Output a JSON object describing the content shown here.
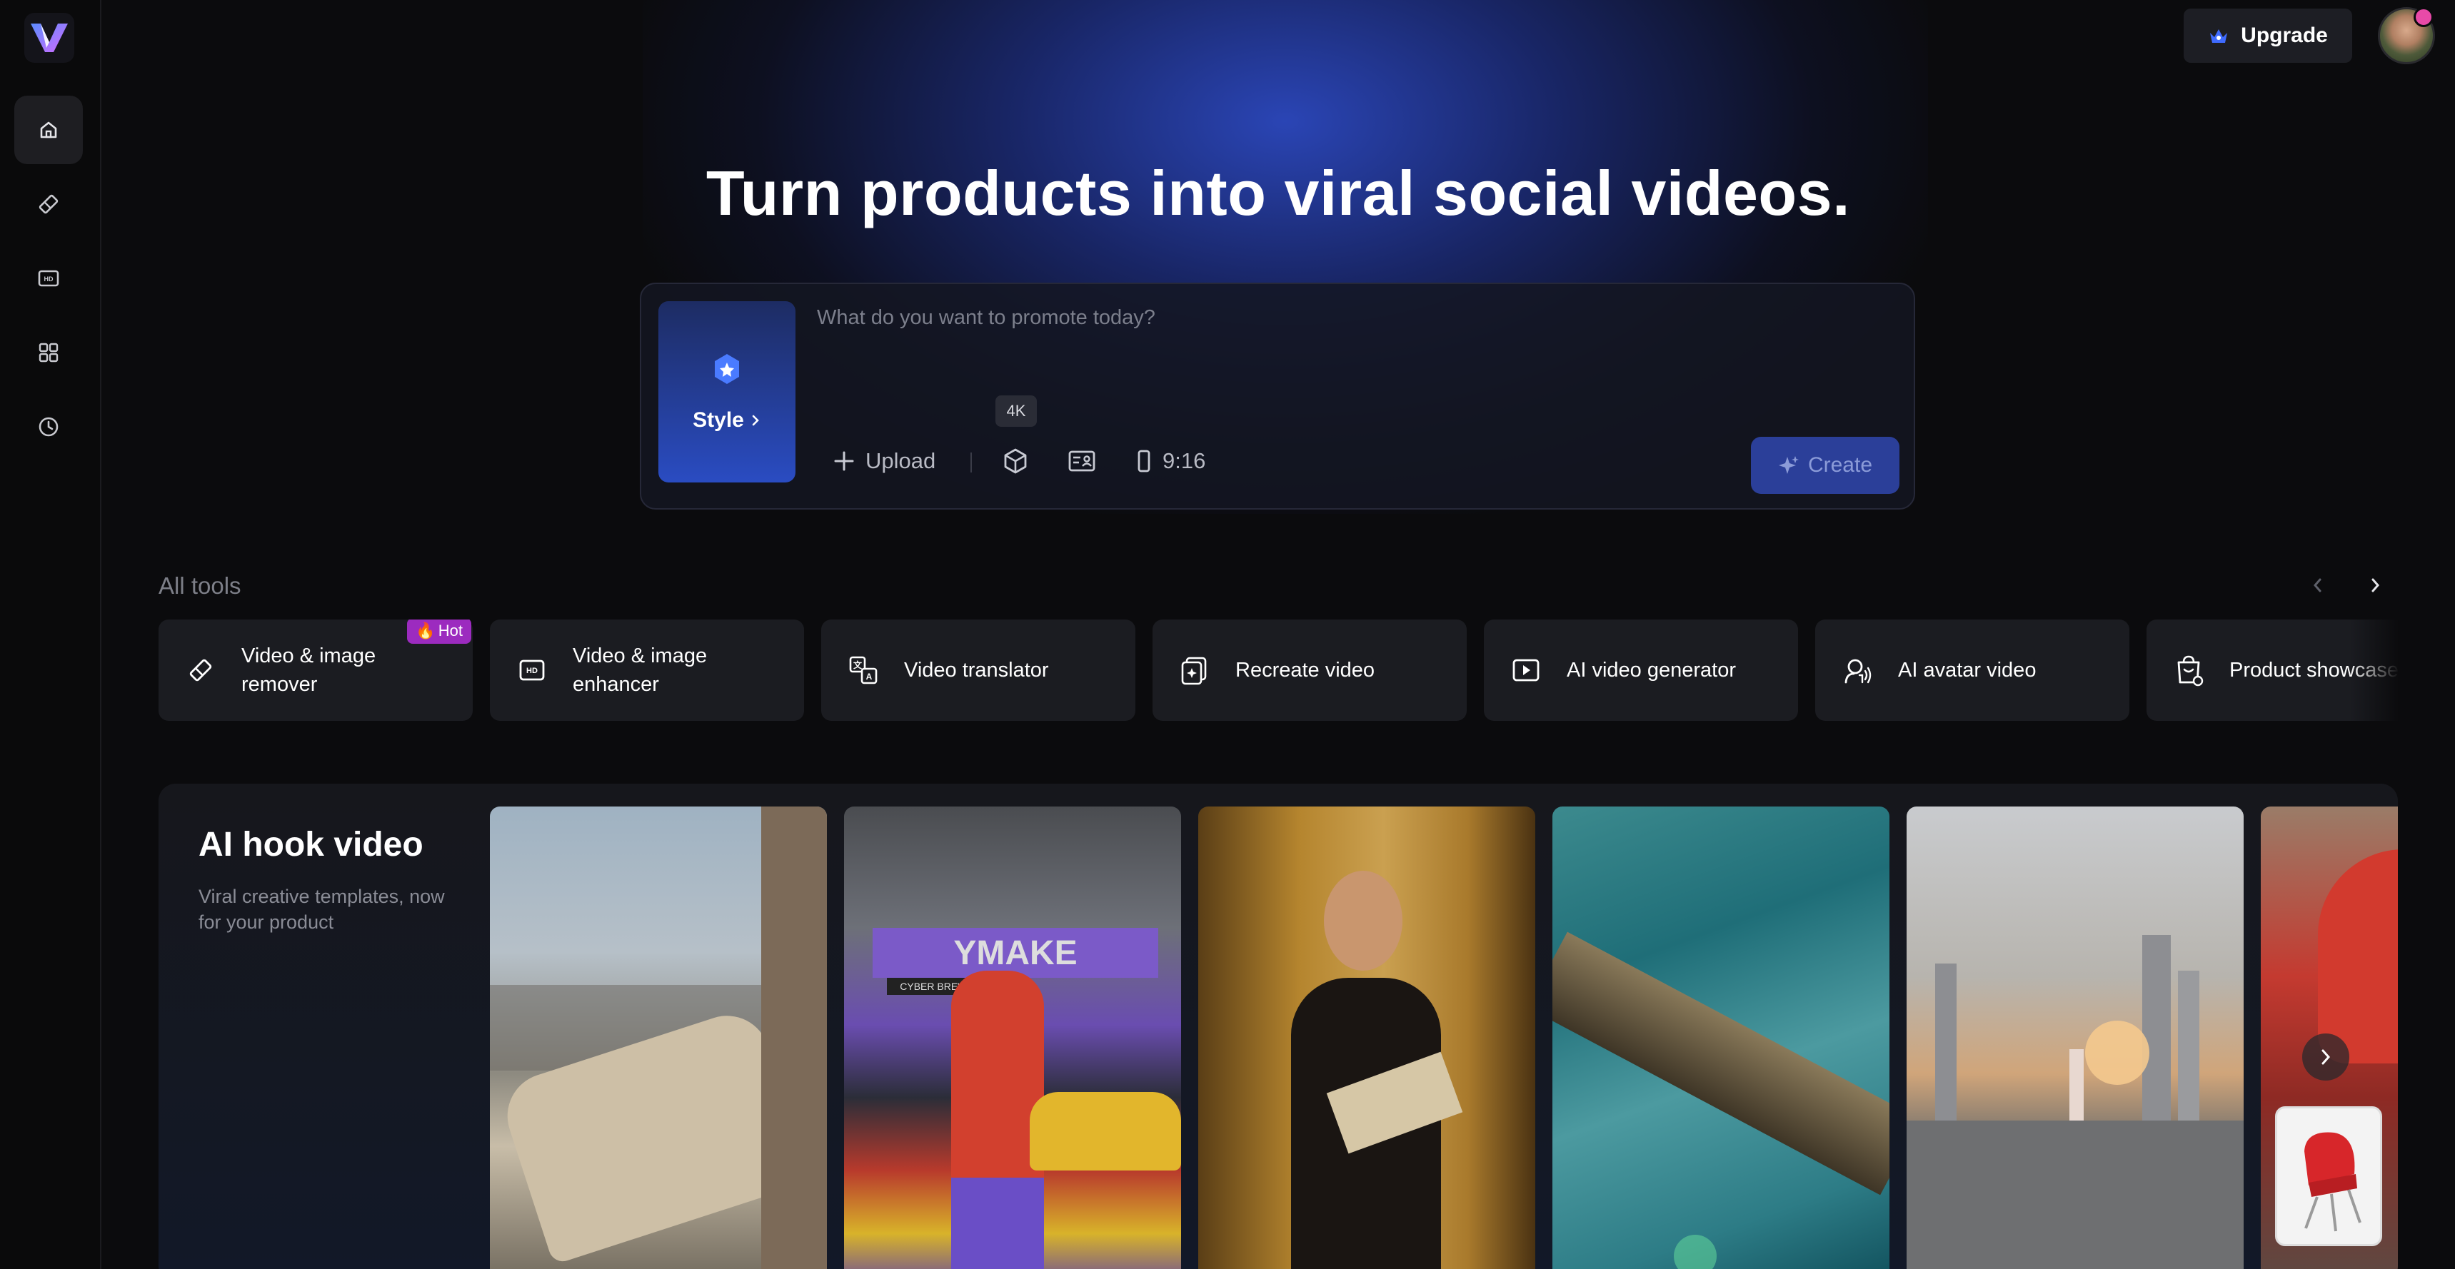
{
  "header": {
    "upgrade_label": "Upgrade",
    "headline": "Turn products into viral social videos."
  },
  "sidebar": {
    "items": [
      {
        "name": "home",
        "active": true
      },
      {
        "name": "eraser",
        "active": false
      },
      {
        "name": "hd",
        "active": false
      },
      {
        "name": "apps",
        "active": false
      },
      {
        "name": "history",
        "active": false
      }
    ]
  },
  "prompt": {
    "placeholder": "What do you want to promote today?",
    "style_label": "Style",
    "upload_label": "Upload",
    "tooltip": "4K",
    "ratio": "9:16",
    "create_label": "Create"
  },
  "tools": {
    "title": "All tools",
    "hot_label": "Hot",
    "items": [
      {
        "label": "Video & image remover",
        "icon": "eraser-icon"
      },
      {
        "label": "Video & image enhancer",
        "icon": "hd-icon"
      },
      {
        "label": "Video translator",
        "icon": "translate-icon"
      },
      {
        "label": "Recreate video",
        "icon": "recreate-icon"
      },
      {
        "label": "AI video generator",
        "icon": "play-icon"
      },
      {
        "label": "AI avatar video",
        "icon": "avatar-icon"
      },
      {
        "label": "Product showcase",
        "icon": "product-icon"
      }
    ]
  },
  "hook": {
    "title": "AI hook video",
    "subtitle": "Viral creative templates, now for your product",
    "thumb_sign": "YMAKE",
    "thumb_sign2": "CYBER BREWS"
  },
  "colors": {
    "accent": "#2a4cc2",
    "hot": "#9c2bbf",
    "background": "#0b0b0d"
  }
}
